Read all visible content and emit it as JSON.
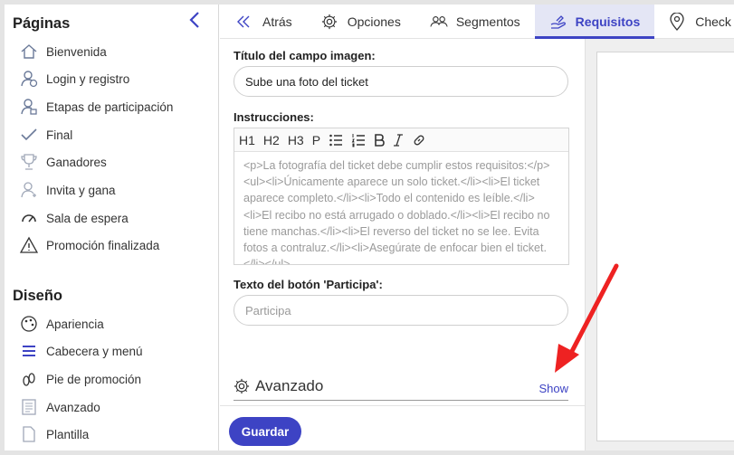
{
  "sidebar": {
    "pages_title": "Páginas",
    "pages": [
      {
        "label": "Bienvenida",
        "icon": "home-icon"
      },
      {
        "label": "Login y registro",
        "icon": "user-add-icon"
      },
      {
        "label": "Etapas de participación",
        "icon": "user-steps-icon"
      },
      {
        "label": "Final",
        "icon": "check-icon"
      },
      {
        "label": "Ganadores",
        "icon": "trophy-icon"
      },
      {
        "label": "Invita y gana",
        "icon": "invite-icon"
      },
      {
        "label": "Sala de espera",
        "icon": "gauge-icon"
      },
      {
        "label": "Promoción finalizada",
        "icon": "warning-icon"
      }
    ],
    "design_title": "Diseño",
    "design": [
      {
        "label": "Apariencia",
        "icon": "palette-icon"
      },
      {
        "label": "Cabecera y menú",
        "icon": "menu-icon"
      },
      {
        "label": "Pie de promoción",
        "icon": "footprint-icon"
      },
      {
        "label": "Avanzado",
        "icon": "document-icon"
      },
      {
        "label": "Plantilla",
        "icon": "file-icon"
      }
    ]
  },
  "tabs": [
    {
      "label": "Atrás",
      "icon": "double-chevron-left-icon"
    },
    {
      "label": "Opciones",
      "icon": "gear-icon"
    },
    {
      "label": "Segmentos",
      "icon": "users-group-icon"
    },
    {
      "label": "Requisitos",
      "icon": "hand-icon",
      "active": true
    },
    {
      "label": "Check in",
      "icon": "map-pin-icon"
    }
  ],
  "form": {
    "image_title_label": "Título del campo imagen:",
    "image_title_value": "Sube una foto del ticket",
    "instructions_label": "Instrucciones:",
    "toolbar": [
      "H1",
      "H2",
      "H3",
      "P",
      "bullet-list-icon",
      "numbered-list-icon",
      "bold-icon",
      "italic-icon",
      "link-icon"
    ],
    "instructions_value": "<p>La fotografía del ticket debe cumplir estos requisitos:</p><ul><li>Únicamente aparece un solo ticket.</li><li>El ticket aparece completo.</li><li>Todo el contenido es leíble.</li><li>El recibo no está arrugado o doblado.</li><li>El recibo no tiene manchas.</li><li>El reverso del ticket no se lee. Evita fotos a contraluz.</li><li>Asegúrate de enfocar bien el ticket.</li></ul>",
    "button_text_label": "Texto del botón 'Participa':",
    "button_text_placeholder": "Participa",
    "advanced_title": "Avanzado",
    "show_link": "Show"
  },
  "footer": {
    "save_label": "Guardar"
  },
  "colors": {
    "accent": "#3d43c4",
    "arrow": "#ee2222",
    "active_tab_bg": "#e4e6f5"
  }
}
